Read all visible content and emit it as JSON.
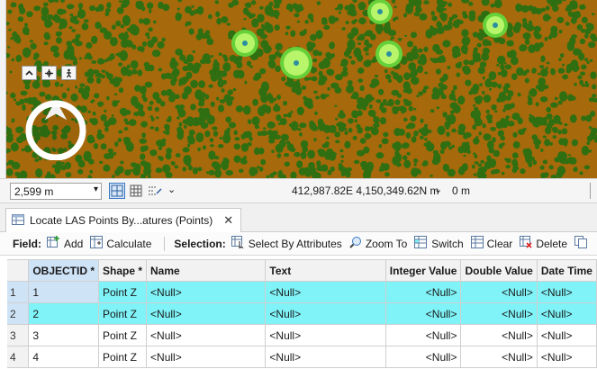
{
  "colors": {
    "map_ground": "#a6690b",
    "vegetation": "#2f6f12",
    "highlight_fill": "#b8f56a",
    "highlight_point": "#2c8fa0",
    "selected_row": "#7ff3f7"
  },
  "map": {
    "nav_icons": [
      "collapse-up-icon",
      "full-extent-icon",
      "pedestrian-icon"
    ],
    "compass_icon": "north-arrow-compass-icon"
  },
  "statusbar": {
    "scale_value": "2,599 m",
    "coordinates": "412,987.82E 4,150,349.62N m",
    "elevation": "0 m"
  },
  "tab": {
    "title": "Locate LAS Points By...atures (Points)",
    "close_glyph": "✕"
  },
  "toolbar": {
    "field_label": "Field:",
    "add_label": "Add",
    "calculate_label": "Calculate",
    "selection_label": "Selection:",
    "select_by_attributes_label": "Select By Attributes",
    "zoom_to_label": "Zoom To",
    "switch_label": "Switch",
    "clear_label": "Clear",
    "delete_label": "Delete"
  },
  "table": {
    "columns": [
      "OBJECTID *",
      "Shape *",
      "Name",
      "Text",
      "Integer Value",
      "Double Value",
      "Date Time"
    ],
    "rows": [
      {
        "num": "1",
        "objectid": "1",
        "shape": "Point Z",
        "name": "<Null>",
        "text": "<Null>",
        "int": "<Null>",
        "dbl": "<Null>",
        "dt": "<Null>",
        "selected": true
      },
      {
        "num": "2",
        "objectid": "2",
        "shape": "Point Z",
        "name": "<Null>",
        "text": "<Null>",
        "int": "<Null>",
        "dbl": "<Null>",
        "dt": "<Null>",
        "selected": true
      },
      {
        "num": "3",
        "objectid": "3",
        "shape": "Point Z",
        "name": "<Null>",
        "text": "<Null>",
        "int": "<Null>",
        "dbl": "<Null>",
        "dt": "<Null>",
        "selected": false
      },
      {
        "num": "4",
        "objectid": "4",
        "shape": "Point Z",
        "name": "<Null>",
        "text": "<Null>",
        "int": "<Null>",
        "dbl": "<Null>",
        "dt": "<Null>",
        "selected": false
      }
    ]
  }
}
